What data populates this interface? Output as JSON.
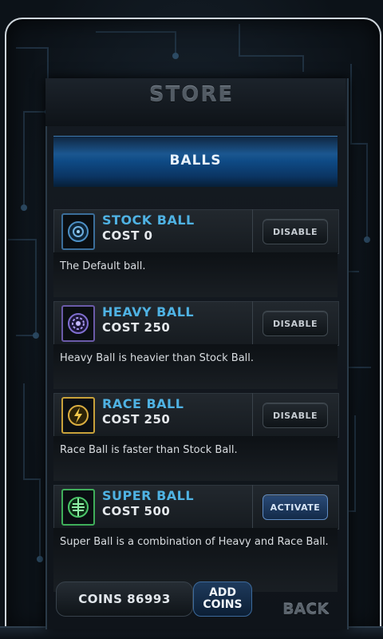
{
  "store": {
    "title": "STORE"
  },
  "tab": {
    "label": "BALLS"
  },
  "items": [
    {
      "name": "STOCK BALL",
      "cost": "COST 0",
      "button": "DISABLE",
      "description": "The Default ball.",
      "icon": "stock-ball-icon",
      "icon_color": "#3b6e9a"
    },
    {
      "name": "HEAVY BALL",
      "cost": "COST 250",
      "button": "DISABLE",
      "description": "Heavy Ball is heavier than Stock Ball.",
      "icon": "heavy-ball-icon",
      "icon_color": "#6a5aa8"
    },
    {
      "name": "RACE BALL",
      "cost": "COST 250",
      "button": "DISABLE",
      "description": "Race Ball is faster than Stock Ball.",
      "icon": "race-ball-icon",
      "icon_color": "#c8a13a"
    },
    {
      "name": "SUPER BALL",
      "cost": "COST 500",
      "button": "ACTIVATE",
      "description": "Super Ball is a combination of Heavy and Race Ball.",
      "icon": "super-ball-icon",
      "icon_color": "#3fae5a"
    }
  ],
  "footer": {
    "coins": "COINS 86993",
    "add_coins_line1": "ADD",
    "add_coins_line2": "COINS",
    "back": "BACK"
  },
  "colors": {
    "item_name": "#4fb2e3",
    "tab_blue": "#1b5790",
    "activate_blue": "#2a4b78"
  }
}
